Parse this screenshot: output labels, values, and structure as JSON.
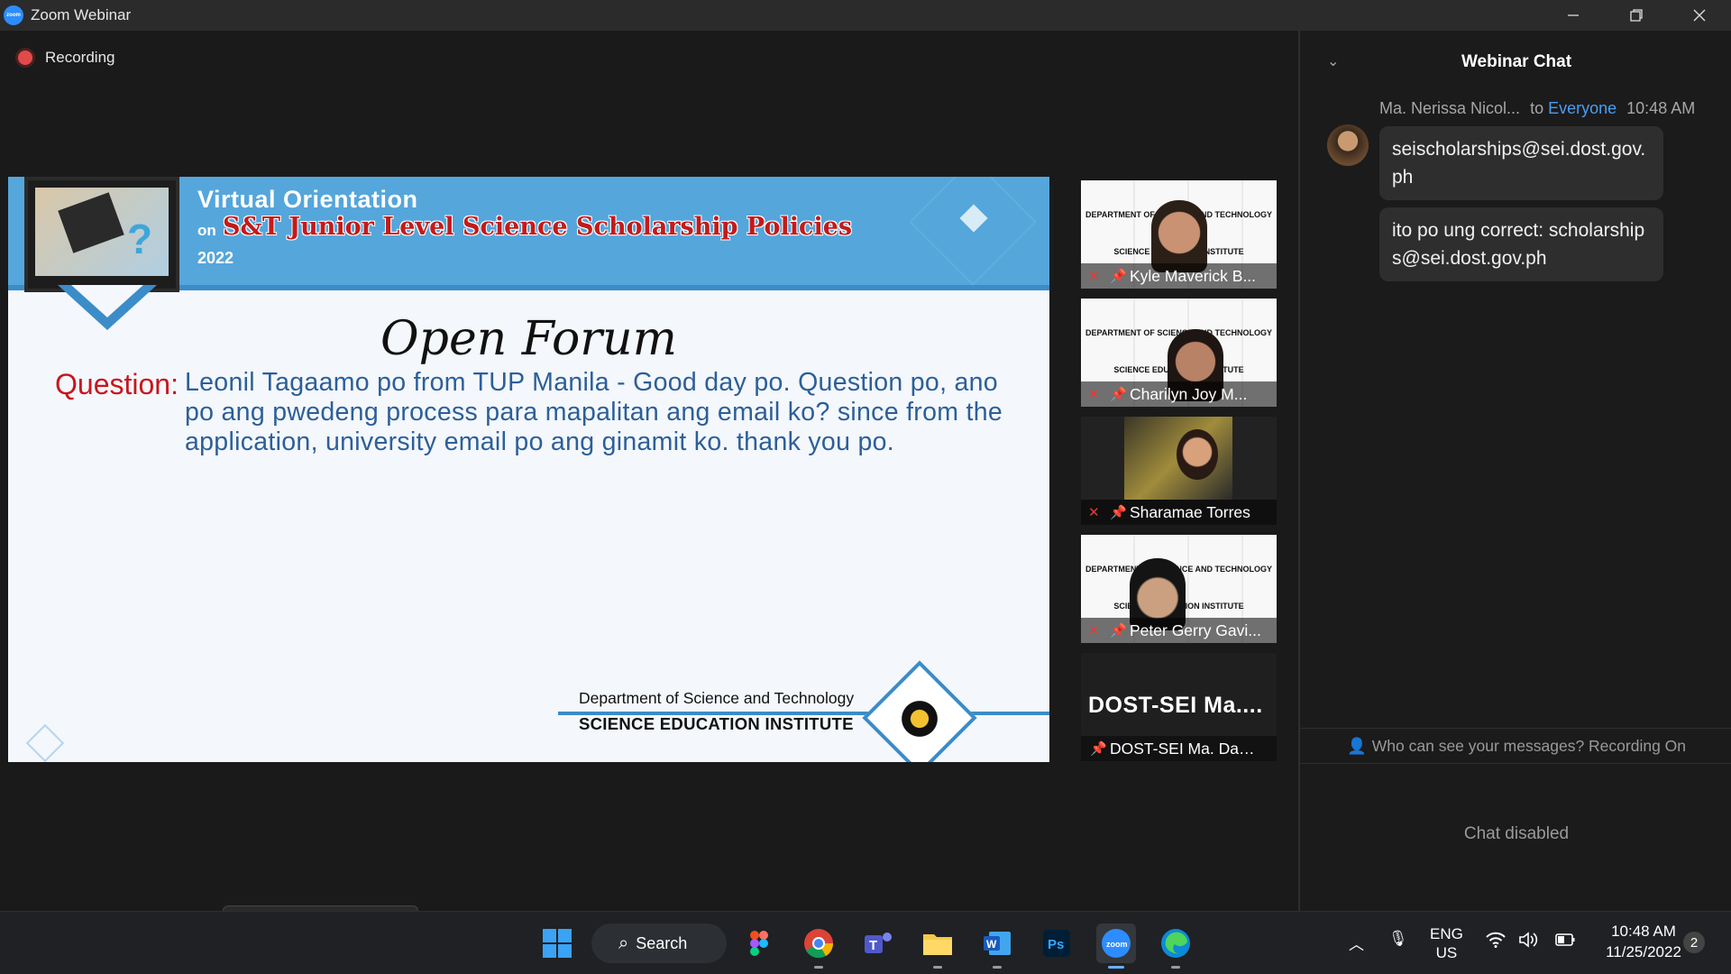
{
  "window": {
    "title": "Zoom Webinar",
    "logo_text": "zoom"
  },
  "meeting": {
    "recording_label": "Recording"
  },
  "slide": {
    "title": "Virtual Orientation",
    "on": "on",
    "subtitle": "S&T Junior Level Science Scholarship Policies",
    "year": "2022",
    "heading": "Open Forum",
    "question_label": "Question:",
    "question_text": "Leonil Tagaamo po from TUP Manila - Good day po. Question po, ano po ang pwedeng process para mapalitan ang email ko? since from the application, university email po ang ginamit ko. thank you po.",
    "footer_dept": "Department of Science and Technology",
    "footer_inst": "SCIENCE EDUCATION INSTITUTE"
  },
  "participants": [
    {
      "name": "Kyle Maverick B...",
      "muted": true,
      "band_top": "DEPARTMENT OF SCIENCE AND TECHNOLOGY",
      "band_bottom": "SCIENCE EDUCATION INSTITUTE"
    },
    {
      "name": "Charilyn Joy M...",
      "muted": true,
      "band_top": "DEPARTMENT OF SCIENCE AND TECHNOLOGY",
      "band_bottom": "SCIENCE EDUCATION INSTITUTE"
    },
    {
      "name": "Sharamae Torres",
      "muted": true
    },
    {
      "name": "Peter Gerry Gavi...",
      "muted": true,
      "band_top": "DEPARTMENT OF SCIENCE AND TECHNOLOGY",
      "band_bottom": "SCIENCE EDUCATION INSTITUTE"
    },
    {
      "name": "DOST-SEI Ma. Daisy...",
      "display_name": "DOST-SEI  Ma....",
      "muted": false
    }
  ],
  "chat": {
    "title": "Webinar Chat",
    "sender": "Ma. Nerissa Nicol...",
    "to_prefix": "to",
    "recipient": "Everyone",
    "time": "10:48 AM",
    "messages": [
      "seischolarships@sei.dost.gov.ph",
      "ito po ung correct: scholarships@sei.dost.gov.ph"
    ],
    "visibility_note": "Who can see your messages? Recording On",
    "disabled_note": "Chat disabled"
  },
  "taskbar": {
    "search_label": "Search",
    "apps": [
      "windows-start",
      "search",
      "figma",
      "chrome",
      "teams",
      "file-explorer",
      "word",
      "photoshop",
      "zoom",
      "edge"
    ],
    "lang_top": "ENG",
    "lang_bottom": "US",
    "time": "10:48 AM",
    "date": "11/25/2022",
    "notification_count": "2",
    "accent": "#6ab0ff"
  },
  "colors": {
    "slide_banner": "#55a6db",
    "question_red": "#c8161d",
    "question_blue": "#2c5f99",
    "chat_link": "#4a9df5",
    "recording_dot": "#e24a4a"
  }
}
